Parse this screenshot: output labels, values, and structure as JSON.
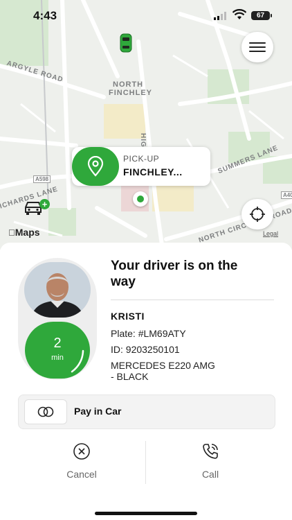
{
  "status_bar": {
    "time": "4:43",
    "battery": "67"
  },
  "map": {
    "labels": {
      "argyle": "ARGYLE ROAD",
      "north": "NORTH",
      "finchley": "FINCHLEY",
      "summers": "SUMMERS LANE",
      "a598": "A598",
      "a406": "A406",
      "circular": "NORTH CIRCULAR ROAD",
      "richards": "ICHARDS LANE",
      "high": "HIGH"
    },
    "maps_logo": "Maps",
    "legal": "Legal",
    "pickup": {
      "label": "PICK-UP",
      "value": "FINCHLEY..."
    }
  },
  "driver": {
    "headline": "Your driver is on the way",
    "name": "KRISTI",
    "plate": "Plate: #LM69ATY",
    "id": "ID: 9203250101",
    "car_line1": "MERCEDES E220 AMG",
    "car_line2": "- BLACK",
    "eta_value": "2",
    "eta_unit": "min"
  },
  "payment": {
    "label": "Pay in Car"
  },
  "actions": {
    "cancel": "Cancel",
    "call": "Call"
  },
  "colors": {
    "accent": "#2fa83b"
  }
}
